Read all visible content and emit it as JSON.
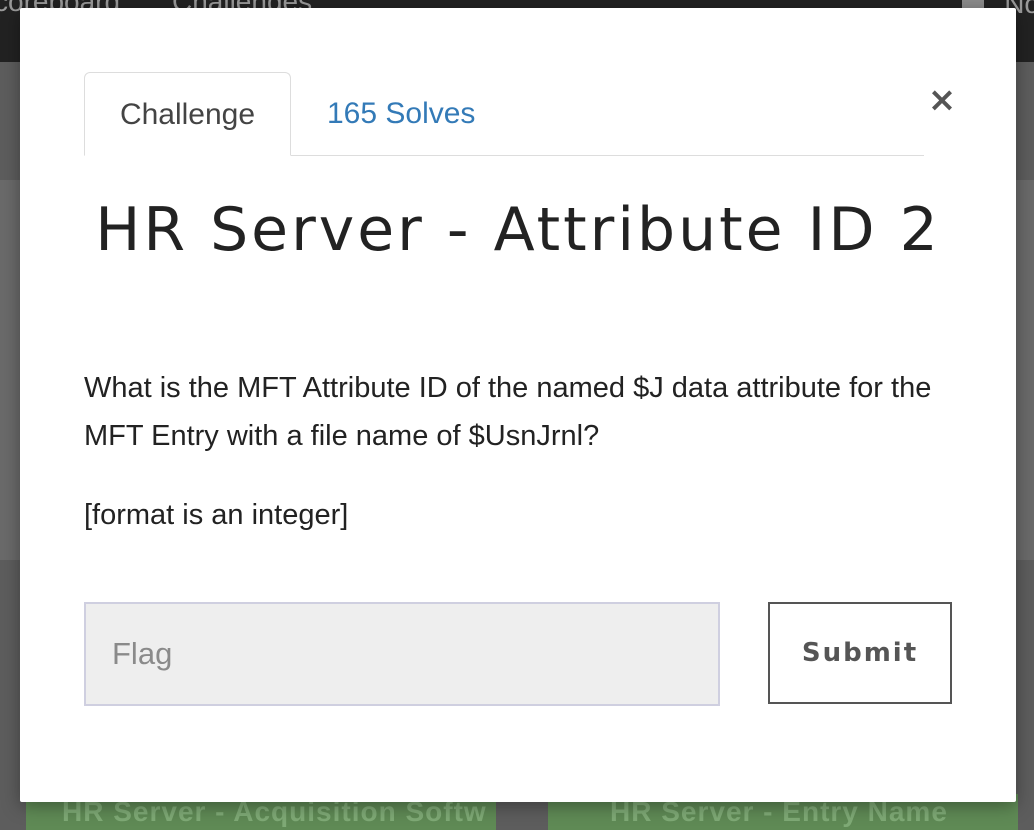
{
  "background": {
    "nav_items": [
      "coreboard",
      "Challenges"
    ],
    "nav_right_text": "No",
    "cards": [
      "HR Server - Acquisition Softw",
      "HR Server - Entry Name"
    ],
    "card_color": "#5f8a55"
  },
  "modal": {
    "close_label": "×",
    "tabs": [
      {
        "label": "Challenge",
        "active": true
      },
      {
        "label": "165 Solves",
        "active": false
      }
    ],
    "title": "HR Server - Attribute ID 2",
    "description": "What is the MFT Attribute ID of the named $J data attribute for the MFT Entry with a file name of $UsnJrnl?",
    "format_note": "[format is an integer]",
    "flag_input": {
      "placeholder": "Flag",
      "value": ""
    },
    "submit_label": "Submit"
  },
  "colors": {
    "link": "#337ab7",
    "overlay": "#5e5e5e",
    "input_background": "#eeeeee"
  }
}
